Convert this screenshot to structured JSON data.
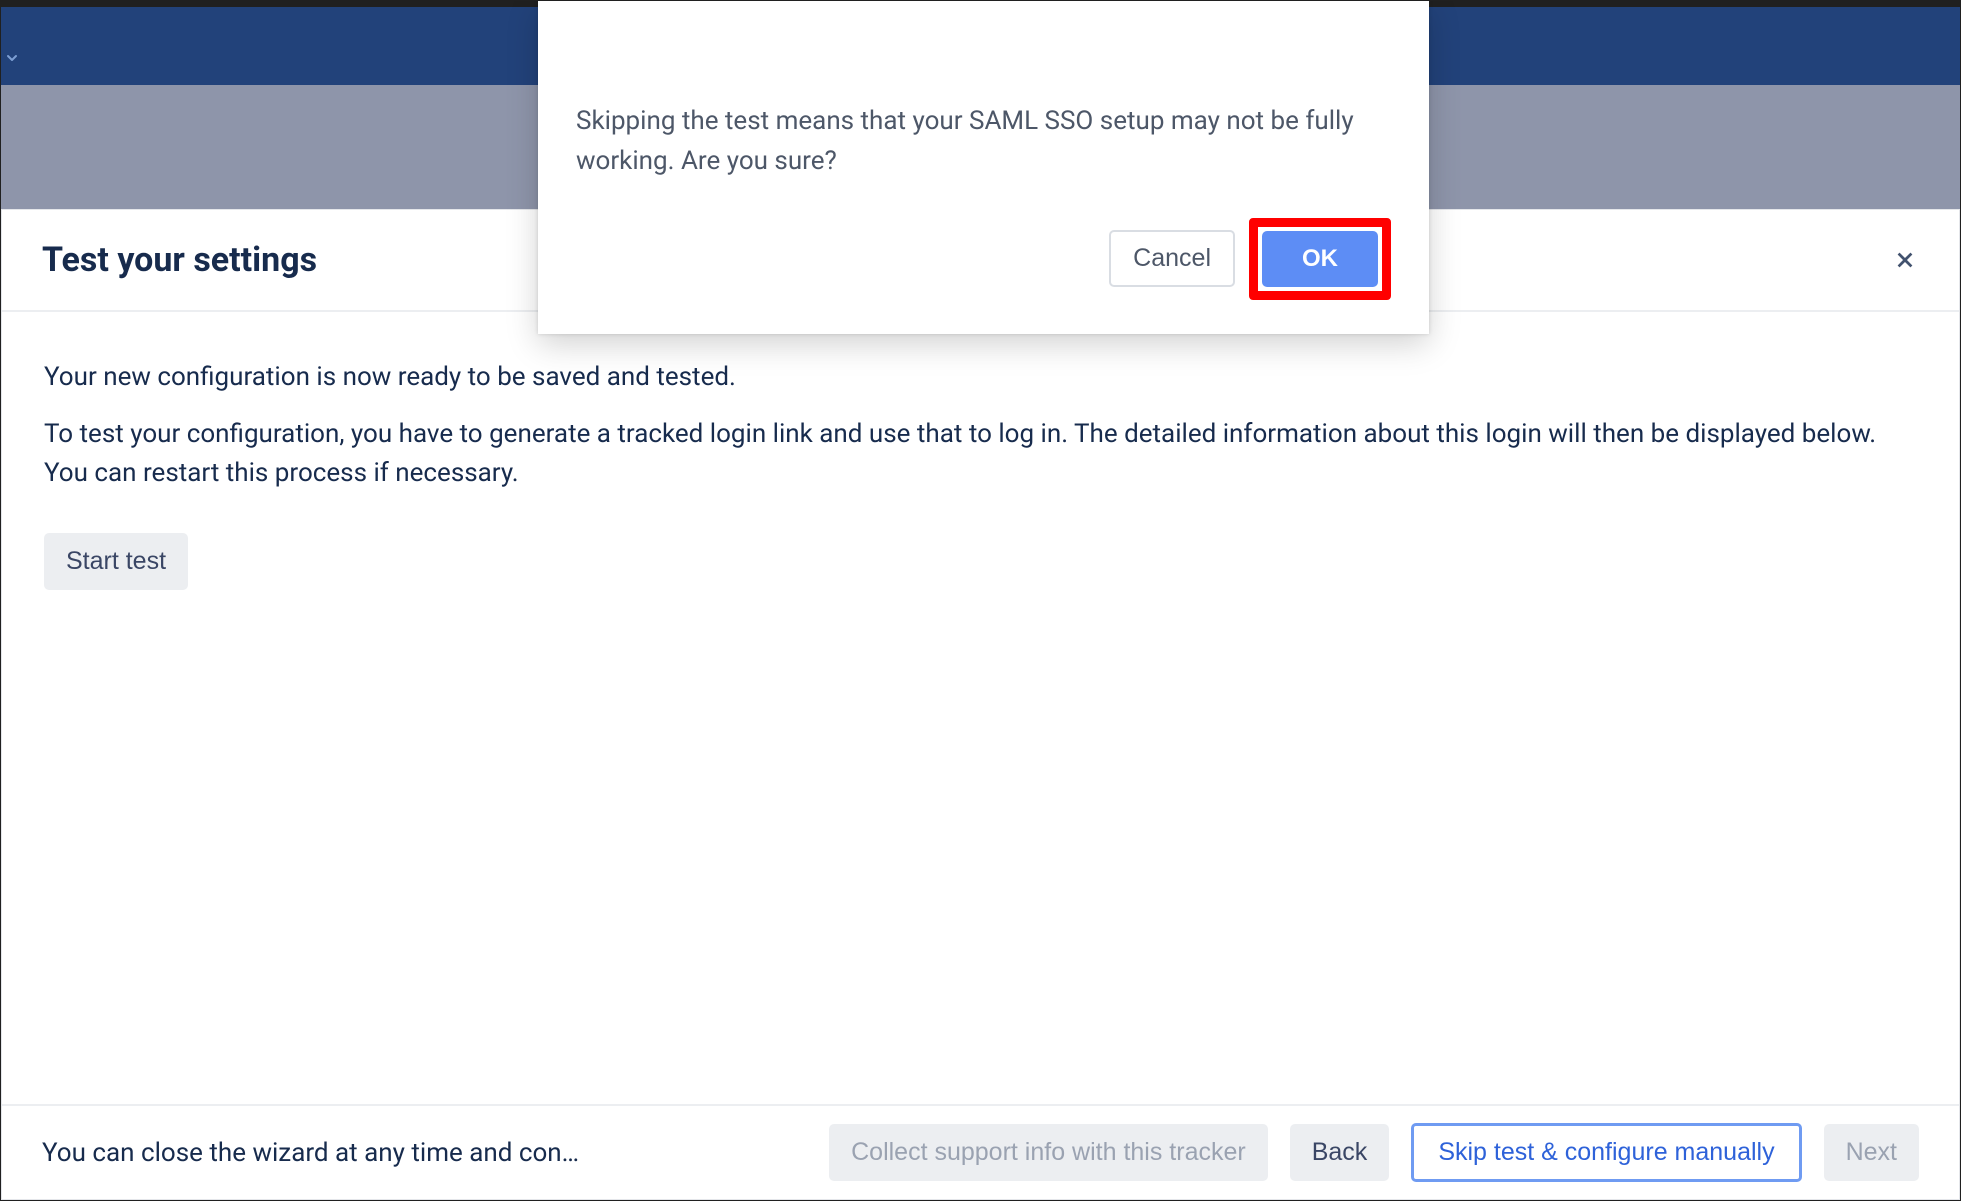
{
  "modal": {
    "message": "Skipping the test means that your SAML SSO setup may not be fully working. Are you sure?",
    "cancel_label": "Cancel",
    "ok_label": "OK"
  },
  "page": {
    "title": "Test your settings",
    "intro_line1": "Your new configuration is now ready to be saved and tested.",
    "intro_line2": "To test your configuration, you have to generate a tracked login link and use that to log in. The detailed information about this login will then be displayed below. You can restart this process if necessary.",
    "start_test_label": "Start test"
  },
  "footer": {
    "hint": "You can close the wizard at any time and con…",
    "collect_label": "Collect support info with this tracker",
    "back_label": "Back",
    "skip_label": "Skip test & configure manually",
    "next_label": "Next"
  }
}
